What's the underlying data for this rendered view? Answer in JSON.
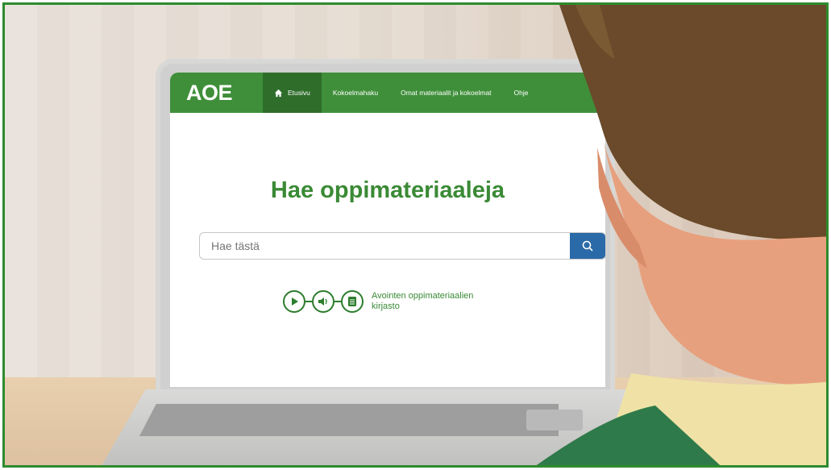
{
  "nav": {
    "logo": "AOE",
    "items": [
      {
        "label": "Etusivu",
        "active": true
      },
      {
        "label": "Kokoelmahaku",
        "active": false
      },
      {
        "label": "Omat materiaalit ja kokoelmat",
        "active": false
      },
      {
        "label": "Ohje",
        "active": false
      }
    ]
  },
  "main": {
    "heading": "Hae oppimateriaaleja",
    "search": {
      "placeholder": "Hae tästä",
      "value": ""
    }
  },
  "brand": {
    "text_line1": "Avointen oppimateriaalien",
    "text_line2": "kirjasto",
    "icons": [
      "play-icon",
      "speaker-icon",
      "document-icon"
    ]
  },
  "colors": {
    "nav_green": "#3f8f3a",
    "nav_active": "#2f6d2b",
    "heading_green": "#3a8a35",
    "search_button": "#2b6aa8",
    "frame_border": "#2e8b2e"
  }
}
